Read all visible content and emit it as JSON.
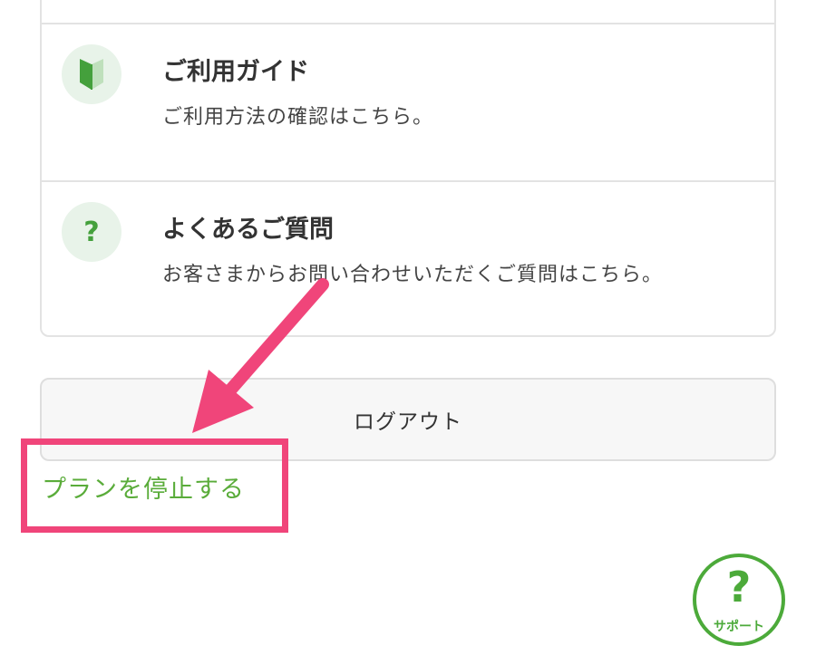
{
  "menu": {
    "items": [
      {
        "icon": "beginner-mark-icon",
        "title": "ご利用ガイド",
        "description": "ご利用方法の確認はこちら。"
      },
      {
        "icon": "question-icon",
        "icon_glyph": "?",
        "title": "よくあるご質問",
        "description": "お客さまからお問い合わせいただくご質問はこちら。"
      }
    ]
  },
  "logout_label": "ログアウト",
  "stop_plan_label": "プランを停止する",
  "support": {
    "glyph": "?",
    "label": "サポート"
  },
  "colors": {
    "accent_green": "#5aac3a",
    "icon_bg": "#e8f3e9",
    "highlight_pink": "#f0457a"
  }
}
